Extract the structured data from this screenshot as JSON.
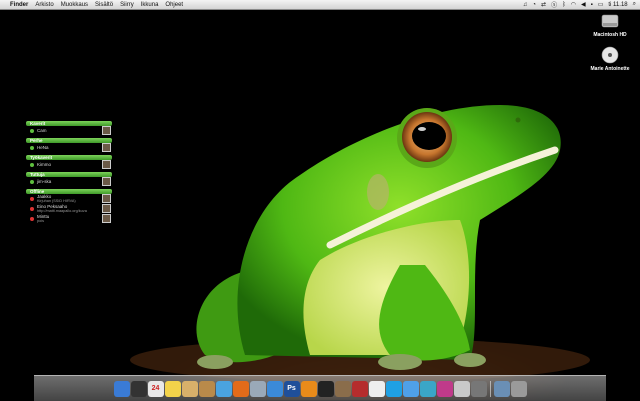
{
  "menubar": {
    "apple_glyph": "",
    "app_menu": "Finder",
    "menus": [
      "Arkisto",
      "Muokkaus",
      "Sisältö",
      "Siirry",
      "Ikkuna",
      "Ohjeet"
    ],
    "clock": "ti 11.18"
  },
  "desktop_icons": [
    {
      "label": "Macintosh HD",
      "icon": "hard-drive-icon"
    },
    {
      "label": "Marie Antoinette",
      "icon": "disc-icon"
    }
  ],
  "widget": {
    "groups": [
      {
        "title": "Kaverit",
        "contacts": [
          {
            "name": "Cam"
          }
        ]
      },
      {
        "title": "Perhe",
        "contacts": [
          {
            "name": "HeNa"
          }
        ]
      },
      {
        "title": "Työkaverit",
        "contacts": [
          {
            "name": "Kimmo"
          }
        ]
      },
      {
        "title": "Tuttuja",
        "contacts": [
          {
            "name": "jim-ska"
          }
        ]
      },
      {
        "title": "Offline",
        "contacts": [
          {
            "name": "Jaakko",
            "status": "Kirjuhan (SSID HIRVA)"
          },
          {
            "name": "Eino Peksaaho",
            "status": "http://matti.maapallo.org/kuva"
          },
          {
            "name": "Minttu",
            "status": "pois"
          }
        ]
      }
    ]
  },
  "dock": {
    "items": [
      {
        "icon": "finder-icon",
        "color": "#3a7bd5"
      },
      {
        "icon": "dashboard-icon",
        "color": "#333333"
      },
      {
        "icon": "calendar-icon",
        "color": "#e8e8e8",
        "label": "24"
      },
      {
        "icon": "stickies-icon",
        "color": "#f3d34a"
      },
      {
        "icon": "preview-icon",
        "color": "#d8b06a"
      },
      {
        "icon": "address-book-icon",
        "color": "#b98a4a"
      },
      {
        "icon": "itunes-icon",
        "color": "#4aa3e0"
      },
      {
        "icon": "firefox-icon",
        "color": "#e26b1a"
      },
      {
        "icon": "mail-icon",
        "color": "#9aa9b8"
      },
      {
        "icon": "safari-icon",
        "color": "#3b8ad8"
      },
      {
        "icon": "photoshop-icon",
        "color": "#1f4f9a",
        "label": "Ps"
      },
      {
        "icon": "vlc-icon",
        "color": "#e98b1a"
      },
      {
        "icon": "terminal-icon",
        "color": "#222222"
      },
      {
        "icon": "imovie-icon",
        "color": "#8a6d4b"
      },
      {
        "icon": "photo-booth-icon",
        "color": "#b52d2d"
      },
      {
        "icon": "textedit-icon",
        "color": "#eeeeee"
      },
      {
        "icon": "skype-icon",
        "color": "#1fa0e3"
      },
      {
        "icon": "ichat-icon",
        "color": "#4fa0e8"
      },
      {
        "icon": "dreamweaver-icon",
        "color": "#3aa6c7"
      },
      {
        "icon": "flash-icon",
        "color": "#c03a8a"
      },
      {
        "icon": "acrobat-icon",
        "color": "#c9c9c9"
      },
      {
        "icon": "system-preferences-icon",
        "color": "#777777"
      },
      {
        "icon": "documents-folder-icon",
        "color": "#6a8fb5"
      },
      {
        "icon": "trash-icon",
        "color": "#9a9a9a"
      }
    ]
  }
}
